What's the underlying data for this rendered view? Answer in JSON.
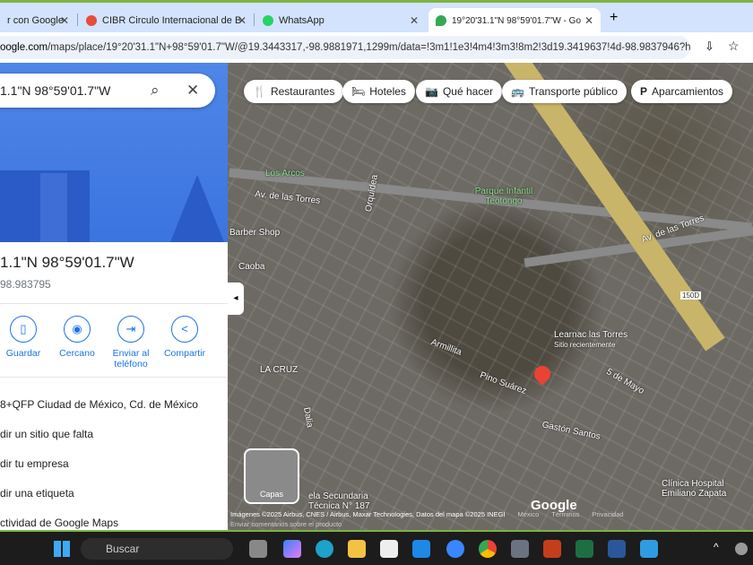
{
  "tabs": [
    {
      "label": "r con Google"
    },
    {
      "label": "CIBR Circulo Internacional de B"
    },
    {
      "label": "WhatsApp"
    },
    {
      "label": "19°20'31.1\"N 98°59'01.7\"W - Go"
    }
  ],
  "address": {
    "domain": "oogle.com",
    "path": "/maps/place/19°20'31.1\"N+98°59'01.7\"W/@19.3443317,-98.9881971,1299m/data=!3m1!1e3!4m4!3m3!8m2!3d19.3419637!4d-98.9837946?hl..."
  },
  "sidebar": {
    "search_value": "1.1\"N 98°59'01.7\"W",
    "title": "1.1\"N 98°59'01.7\"W",
    "subtitle": "98.983795",
    "actions": [
      {
        "label": "Guardar",
        "icon": "bookmark-icon",
        "glyph": "▯"
      },
      {
        "label": "Cercano",
        "icon": "nearby-icon",
        "glyph": "◉"
      },
      {
        "label": "Enviar al teléfono",
        "icon": "send-to-phone-icon",
        "glyph": "⇥"
      },
      {
        "label": "Compartir",
        "icon": "share-icon",
        "glyph": "<"
      }
    ],
    "rows": [
      "8+QFP Ciudad de México, Cd. de México",
      "dir un sitio que falta",
      "dir tu empresa",
      "dir una etiqueta",
      "ctividad de Google Maps"
    ]
  },
  "map": {
    "chips": [
      {
        "label": "Restaurantes",
        "glyph": "🍴"
      },
      {
        "label": "Hoteles",
        "glyph": "🛏"
      },
      {
        "label": "Qué hacer",
        "glyph": "📷"
      },
      {
        "label": "Transporte público",
        "glyph": "🚌"
      },
      {
        "label": "Aparcamientos",
        "glyph": "P"
      }
    ],
    "labels": [
      "Los Arcos",
      "Parque Infantil Teotongo",
      "Av. de las Torres",
      "Av. de las Torres",
      "Barber Shop",
      "Learnac las Torres",
      "Sitio recientemente",
      "LA CRUZ",
      "Pino Suárez",
      "Gastón Santos",
      "5 de Mayo",
      "Clínica Hospital Emiliano Zapata",
      "ela Secundaria Técnica N° 187",
      "Armillita",
      "Orquídea",
      "Caoba",
      "Dalia",
      "150D"
    ],
    "layers": "Capas",
    "google": "Google",
    "attribution": "Imágenes ©2025 Airbus, CNES / Airbus, Maxar Technologies, Datos del mapa ©2025 INEGI",
    "country": "México",
    "terms": "Términos",
    "privacy": "Privacidad",
    "feedback": "Enviar comentarios sobre el producto"
  },
  "taskbar": {
    "search": "Buscar"
  }
}
